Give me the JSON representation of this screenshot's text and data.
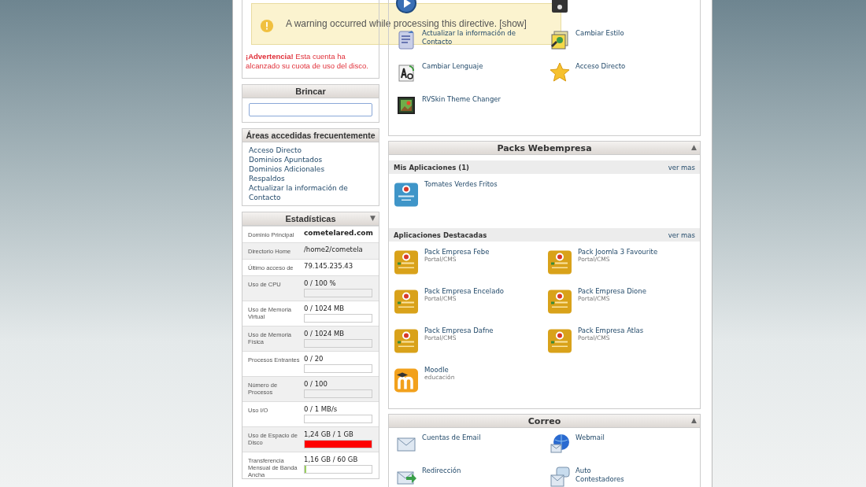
{
  "notice": {
    "text": "A warning occurred while processing this directive.",
    "link": "[show]"
  },
  "sidebar": {
    "quota_warning": "**¡Advertencia!** Esta cuenta ha alcanzado su cuota de uso del disco.",
    "jump": {
      "title": "Brincar"
    },
    "frequent": {
      "title": "Áreas accedidas frecuentemente",
      "links": [
        {
          "label": "Acceso Directo"
        },
        {
          "label": "Dominios Apuntados"
        },
        {
          "label": "Dominios Adicionales"
        },
        {
          "label": "Respaldos"
        },
        {
          "label": "Actualizar la información de Contacto"
        }
      ]
    },
    "stats": {
      "title": "Estadísticas",
      "toggle": "▼",
      "rows": [
        {
          "label": "Dominio Principal",
          "value": "cometelared.com",
          "bold": true
        },
        {
          "label": "Directorio Home",
          "value": "/home2/cometela"
        },
        {
          "label": "Último acceso de",
          "value": "79.145.235.43"
        },
        {
          "label": "Uso de CPU",
          "value": "0 / 100 %",
          "level": 0
        },
        {
          "label": "Uso de Memoria Virtual",
          "value": "0 / 1024 MB",
          "level": 0
        },
        {
          "label": "Uso de Memoria Física",
          "value": "0 / 1024 MB",
          "level": 0
        },
        {
          "label": "Procesos Entrantes",
          "value": "0 / 20",
          "level": 0
        },
        {
          "label": "Número de Procesos",
          "value": "0 / 100",
          "level": 0
        },
        {
          "label": "Uso I/O",
          "value": "0 / 1 MB/s",
          "level": 0
        },
        {
          "label": "Uso de Espacio de Disco",
          "value": "1,24 GB / 1 GB",
          "level": 1
        },
        {
          "label": "Transferencia Mensual de Banda Ancha",
          "value": "1,16 GB / 60 GB",
          "level": 0.02
        }
      ]
    }
  },
  "preferences": {
    "items": [
      {
        "label": "Actualizar la información de Contacto"
      },
      {
        "label": "Cambiar Estilo"
      },
      {
        "label": "Cambiar Lenguaje"
      },
      {
        "label": "Acceso Directo"
      },
      {
        "label": "RVSkin Theme Changer"
      }
    ]
  },
  "packs": {
    "title": "Packs Webempresa",
    "toggle": "▲",
    "sections": [
      {
        "title": "Mis Aplicaciones (1)",
        "more": "ver mas",
        "apps": [
          {
            "kind": "wordpress",
            "name": "Tomates Verdes Fritos"
          }
        ]
      },
      {
        "title": "Aplicaciones Destacadas",
        "more": "ver mas",
        "apps": [
          {
            "kind": "joomla",
            "name": "Pack Empresa Febe",
            "category": "Portal/CMS"
          },
          {
            "kind": "joomla",
            "name": "Pack Joomla 3 Favourite",
            "category": "Portal/CMS"
          },
          {
            "kind": "joomla",
            "name": "Pack Empresa Encelado",
            "category": "Portal/CMS"
          },
          {
            "kind": "joomla",
            "name": "Pack Empresa Dione",
            "category": "Portal/CMS"
          },
          {
            "kind": "joomla",
            "name": "Pack Empresa Dafne",
            "category": "Portal/CMS"
          },
          {
            "kind": "joomla",
            "name": "Pack Empresa Atlas",
            "category": "Portal/CMS"
          },
          {
            "kind": "moodle",
            "name": "Moodle",
            "category": "educación"
          }
        ]
      }
    ]
  },
  "mail": {
    "title": "Correo",
    "toggle": "▲",
    "items": [
      {
        "label": "Cuentas de Email"
      },
      {
        "label": "Webmail"
      },
      {
        "label": "Redirección"
      },
      {
        "label": "Auto\nContestadores"
      }
    ]
  }
}
